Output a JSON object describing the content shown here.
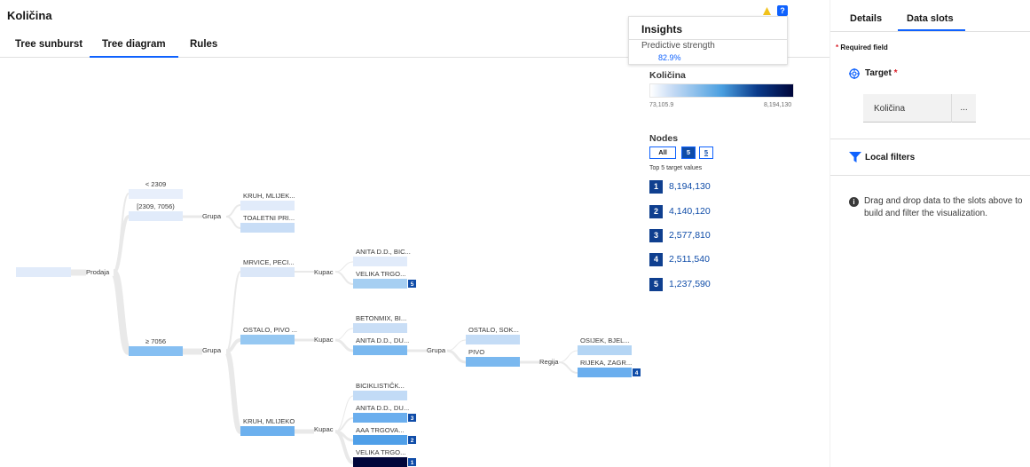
{
  "header": {
    "title": "Količina",
    "tabs": [
      "Tree sunburst",
      "Tree diagram",
      "Rules"
    ],
    "active_tab": "Tree diagram",
    "help_label": "?"
  },
  "tree": {
    "nodes": {
      "root": {
        "label": "",
        "color": "#e1ebfa"
      },
      "prodaja": {
        "label": "Prodaja"
      },
      "lt2309": {
        "label": "< 2309",
        "color": "#e8effb"
      },
      "r2309": {
        "label": "[2309, 7056)",
        "color": "#e1ebfa"
      },
      "ge7056": {
        "label": "≥ 7056",
        "color": "#86bff2"
      },
      "grupa1": {
        "label": "Grupa"
      },
      "grupa2": {
        "label": "Grupa"
      },
      "kruh1": {
        "label": "KRUH, MLIJEK...",
        "color": "#e1ebfa"
      },
      "toaletni": {
        "label": "TOALETNI PRI...",
        "color": "#c8ddf6"
      },
      "mrvice": {
        "label": "MRVICE, PECI...",
        "color": "#dbe7f8"
      },
      "ostalo1": {
        "label": "OSTALO, PIVO ...",
        "color": "#96c8f2"
      },
      "kruh2": {
        "label": "KRUH, MLIJEKO",
        "color": "#6cb0ee"
      },
      "kupac1": {
        "label": "Kupac"
      },
      "kupac2": {
        "label": "Kupac"
      },
      "kupac3": {
        "label": "Kupac"
      },
      "anita1": {
        "label": "ANITA D.D., BIC...",
        "color": "#e1ebfa"
      },
      "velika1": {
        "label": "VELIKA TRGO...",
        "color": "#a6cff2",
        "rank": "5"
      },
      "betonmix": {
        "label": "BETONMIX, BI...",
        "color": "#c9def6"
      },
      "anita2": {
        "label": "ANITA D.D., DU...",
        "color": "#7ab8ef"
      },
      "biciklisticki": {
        "label": "BICIKLISTIČK...",
        "color": "#c2dbf6"
      },
      "anita3": {
        "label": "ANITA D.D., DU...",
        "color": "#6aaeee",
        "rank": "3"
      },
      "aaa": {
        "label": "AAA TRGOVA...",
        "color": "#4f9fe8",
        "rank": "2"
      },
      "velika2": {
        "label": "VELIKA TRGO...",
        "color": "#00063a",
        "rank": "1"
      },
      "grupa3": {
        "label": "Grupa"
      },
      "ostalo2": {
        "label": "OSTALO, SOK...",
        "color": "#c4dcf6"
      },
      "pivo": {
        "label": "PIVO",
        "color": "#7ab8ef"
      },
      "regija": {
        "label": "Regija"
      },
      "osijek": {
        "label": "OSIJEK, BJEL...",
        "color": "#b4d5f4"
      },
      "rijeka": {
        "label": "RIJEKA, ZAGR...",
        "color": "#6aaeee",
        "rank": "4"
      }
    }
  },
  "insights": {
    "title": "Insights",
    "label": "Predictive strength",
    "value": "82.9%"
  },
  "legend": {
    "title": "Količina",
    "min": "73,105.9",
    "max": "8,194,130"
  },
  "nodes_panel": {
    "title": "Nodes",
    "filters": [
      "All",
      "5",
      "5"
    ],
    "top_label": "Top 5 target values",
    "ranks": [
      {
        "rank": "1",
        "value": "8,194,130"
      },
      {
        "rank": "2",
        "value": "4,140,120"
      },
      {
        "rank": "3",
        "value": "2,577,810"
      },
      {
        "rank": "4",
        "value": "2,511,540"
      },
      {
        "rank": "5",
        "value": "1,237,590"
      }
    ]
  },
  "side_panel": {
    "tabs": [
      "Details",
      "Data slots"
    ],
    "active_tab": "Data slots",
    "required_text": "Required field",
    "required_star": "*",
    "target_label": "Target",
    "target_value": "Količina",
    "more_label": "...",
    "local_filters_label": "Local filters",
    "info_text": "Drag and drop data to the slots above to build and filter the visualization."
  },
  "colors": {
    "accent": "#0f62fe",
    "rank_badge": "#0f3f8f",
    "required": "#da1e28"
  }
}
